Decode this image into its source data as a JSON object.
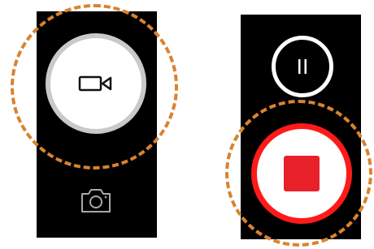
{
  "left_panel": {
    "record_video_button": {
      "icon": "video-camera-icon",
      "ring_color": "#c9c9c9",
      "fill_color": "#ffffff"
    },
    "photo_button": {
      "icon": "photo-camera-icon",
      "icon_color": "#a8a8a8"
    }
  },
  "right_panel": {
    "pause_button": {
      "icon": "pause-icon",
      "ring_color": "#ffffff"
    },
    "stop_button": {
      "icon": "stop-icon",
      "ring_color": "#ff1a1a",
      "square_color": "#e8202a"
    }
  },
  "highlight": {
    "color": "#d9832e",
    "style": "dashed"
  }
}
